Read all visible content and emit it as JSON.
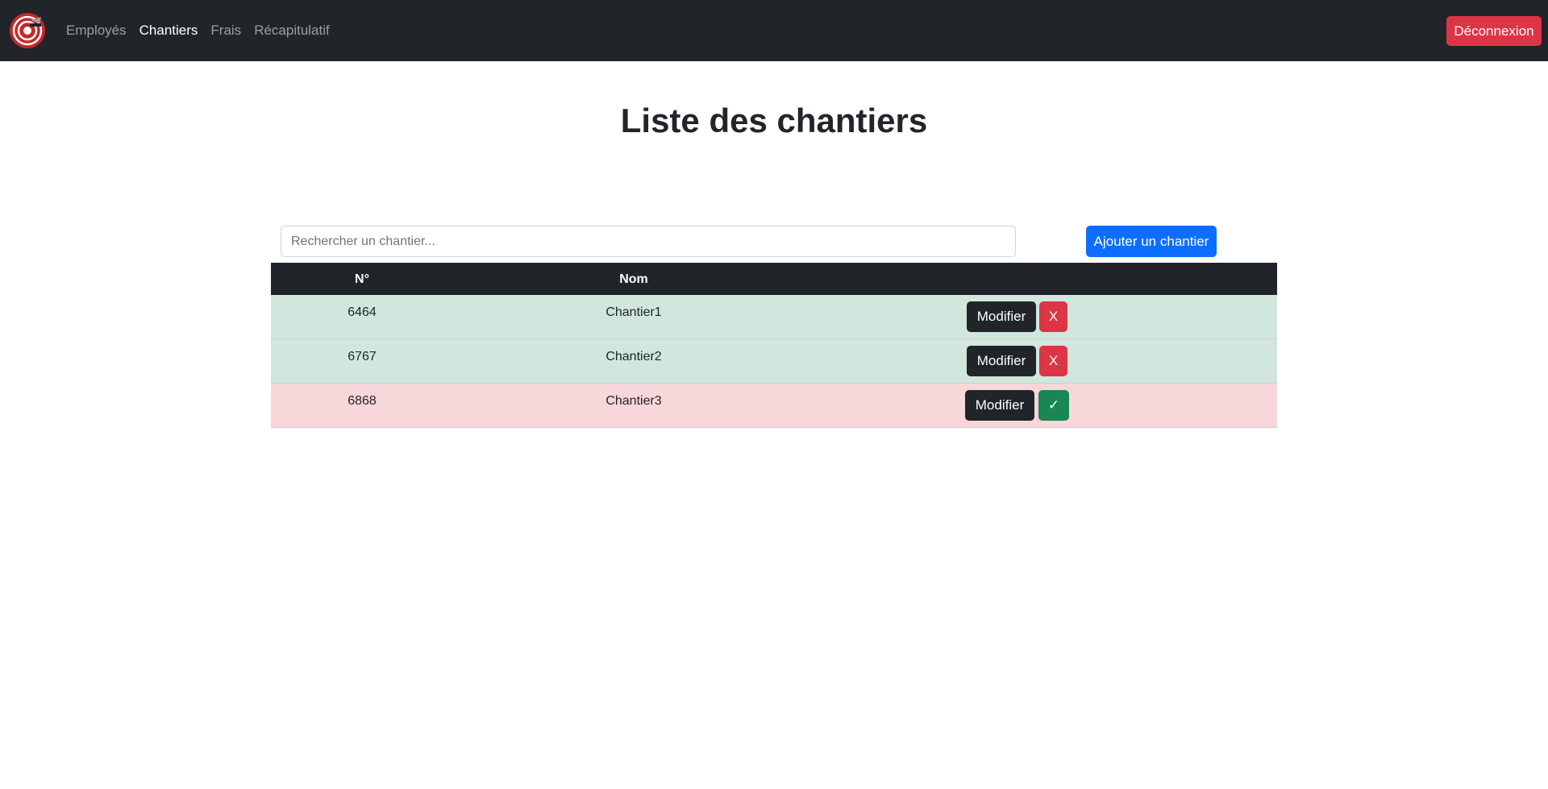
{
  "nav": {
    "links": [
      "Employés",
      "Chantiers",
      "Frais",
      "Récapitulatif"
    ],
    "active_link": "Chantiers",
    "logout_label": "Déconnexion"
  },
  "page": {
    "title": "Liste des chantiers"
  },
  "search": {
    "value": "",
    "placeholder": "Rechercher un chantier..."
  },
  "add_button_label": "Ajouter un chantier",
  "table": {
    "headers": [
      "N°",
      "Nom",
      ""
    ],
    "rows": [
      {
        "num": "6464",
        "nom": "Chantier1",
        "status": "active",
        "modify_label": "Modifier",
        "toggle_label": "X"
      },
      {
        "num": "6767",
        "nom": "Chantier2",
        "status": "active",
        "modify_label": "Modifier",
        "toggle_label": "X"
      },
      {
        "num": "6868",
        "nom": "Chantier3",
        "status": "inactive",
        "modify_label": "Modifier",
        "toggle_label": "✓"
      }
    ]
  },
  "colors": {
    "navbar": "#212529",
    "danger": "#dc3545",
    "primary": "#0d6efd",
    "success": "#198754",
    "row_active": "#d1e7dd",
    "row_inactive": "#f8d7da"
  },
  "icons": {
    "logo": "target-logo-icon"
  }
}
